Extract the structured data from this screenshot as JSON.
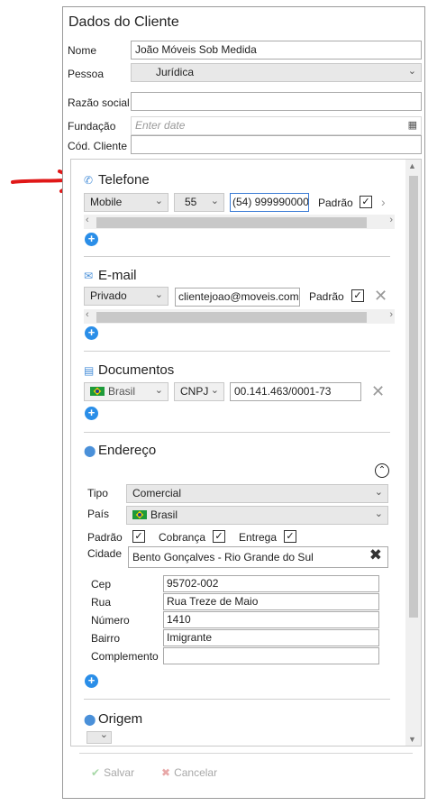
{
  "window": {
    "title": "Dados do Cliente"
  },
  "fields": {
    "nome": {
      "label": "Nome",
      "value": "João Móveis Sob Medida"
    },
    "pessoa": {
      "label": "Pessoa",
      "value": "Jurídica"
    },
    "razao": {
      "label": "Razão social",
      "value": ""
    },
    "fundacao": {
      "label": "Fundação",
      "placeholder": "Enter date"
    },
    "cod": {
      "label": "Cód. Cliente",
      "value": ""
    }
  },
  "telefone": {
    "title": "Telefone",
    "type": "Mobile",
    "ddi": "55",
    "number": "(54) 999990000",
    "padrao_label": "Padrão",
    "padrao_checked": true
  },
  "email": {
    "title": "E-mail",
    "type": "Privado",
    "address": "clientejoao@moveis.com",
    "padrao_label": "Padrão",
    "padrao_checked": true
  },
  "documentos": {
    "title": "Documentos",
    "country": "Brasil",
    "doc_type": "CNPJ",
    "number": "00.141.463/0001-73"
  },
  "endereco": {
    "title": "Endereço",
    "tipo_label": "Tipo",
    "tipo_value": "Comercial",
    "pais_label": "País",
    "pais_value": "Brasil",
    "padrao_label": "Padrão",
    "cobranca_label": "Cobrança",
    "entrega_label": "Entrega",
    "cidade_label": "Cidade",
    "cidade_value": "Bento Gonçalves - Rio Grande do Sul",
    "cep_label": "Cep",
    "cep_value": "95702-002",
    "rua_label": "Rua",
    "rua_value": "Rua Treze de Maio",
    "numero_label": "Número",
    "numero_value": "1410",
    "bairro_label": "Bairro",
    "bairro_value": "Imigrante",
    "complemento_label": "Complemento",
    "complemento_value": ""
  },
  "origem": {
    "title": "Origem",
    "value": ""
  },
  "footer": {
    "salvar": "Salvar",
    "cancelar": "Cancelar"
  },
  "colors": {
    "accent": "#2a8ee8",
    "arrow": "#e01818"
  }
}
